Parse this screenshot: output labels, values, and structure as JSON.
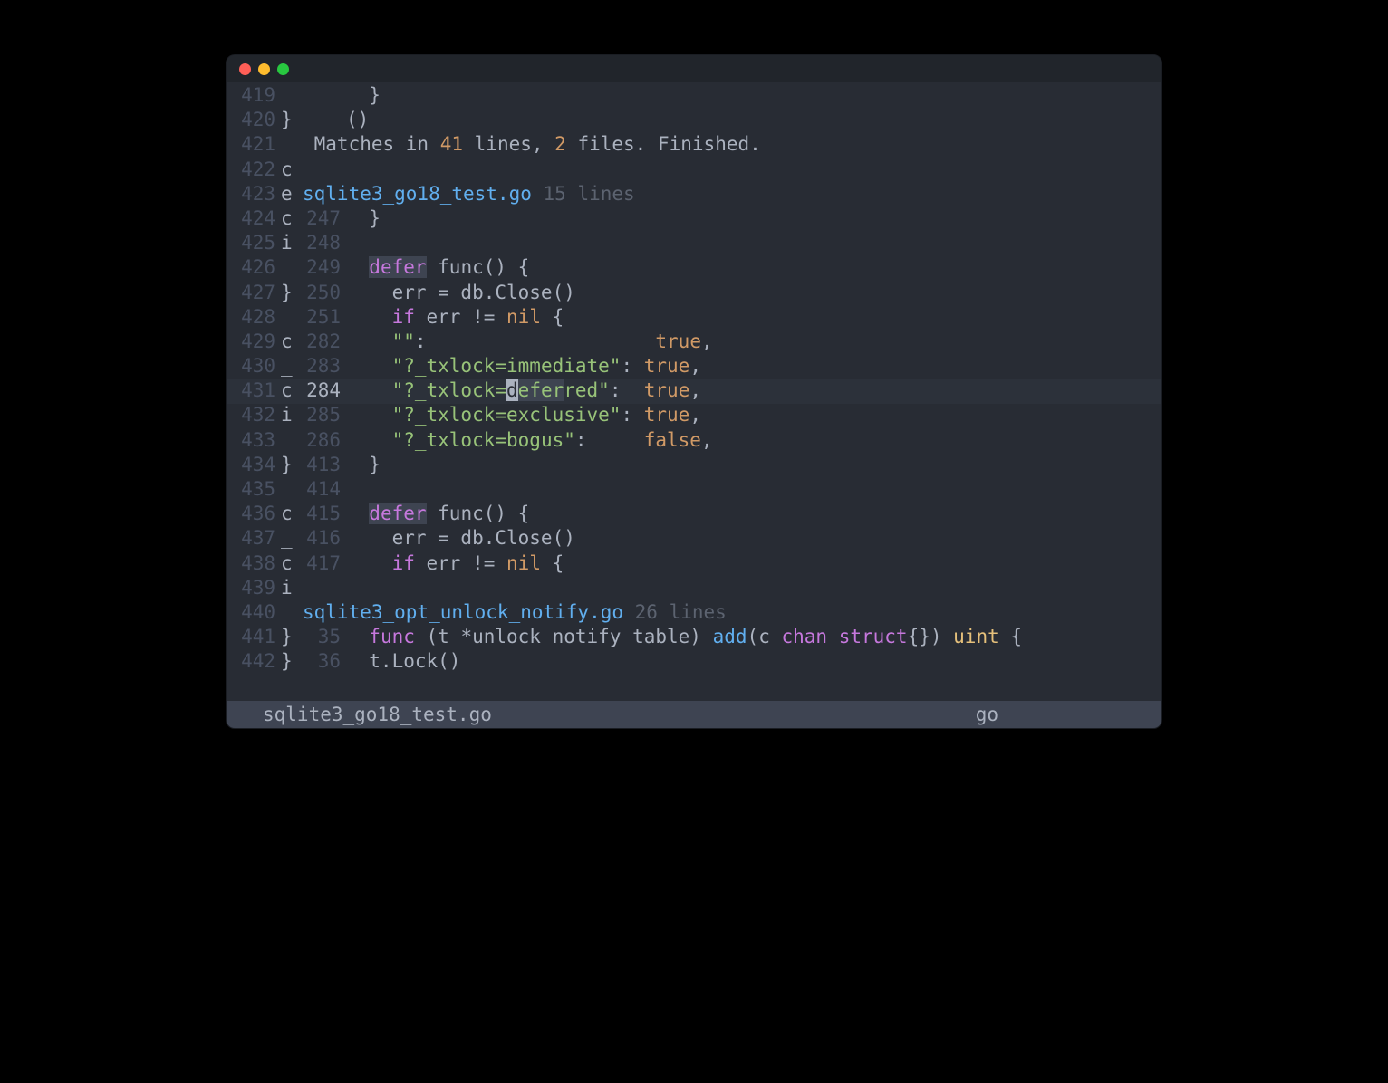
{
  "search": {
    "summary_prefix": " Matches in ",
    "lines_count": "41",
    "summary_mid1": " lines, ",
    "files_count": "2",
    "summary_suffix": " files. Finished."
  },
  "file1": {
    "name": "sqlite3_go18_test.go",
    "line_count": " 15 lines"
  },
  "file2": {
    "name": "sqlite3_opt_unlock_notify.go",
    "line_count": " 26 lines"
  },
  "gutter": {
    "l419": "419",
    "l420": "420",
    "l421": "421",
    "l422": "422",
    "l423": "423",
    "l424": "424",
    "l425": "425",
    "l426": "426",
    "l427": "427",
    "l428": "428",
    "l429": "429",
    "l430": "430",
    "l431": "431",
    "l432": "432",
    "l433": "433",
    "l434": "434",
    "l435": "435",
    "l436": "436",
    "l437": "437",
    "l438": "438",
    "l439": "439",
    "l440": "440",
    "l441": "441",
    "l442": "442"
  },
  "mid": {
    "l419": " ",
    "l420": "}",
    "l421": " ",
    "l422": "c",
    "l423": "e",
    "l424": "c",
    "l425": "i",
    "l426": " ",
    "l427": "}",
    "l428": " ",
    "l429": "c",
    "l430": "_",
    "l431": "c",
    "l432": "i",
    "l433": " ",
    "l434": "}",
    "l435": " ",
    "l436": "c",
    "l437": "_",
    "l438": "c",
    "l439": "i",
    "l440": " ",
    "l441": "}",
    "l442": "}"
  },
  "rgutter": {
    "r247": "247",
    "r248": "248",
    "r249": "249",
    "r250": "250",
    "r251": "251",
    "r282": "282",
    "r283": "283",
    "r284": "284",
    "r285": "285",
    "r286": "286",
    "r413": "413",
    "r414": "414",
    "r415": "415",
    "r416": "416",
    "r417": "417",
    "r35": "35",
    "r36": "36"
  },
  "code": {
    "c419": "  }",
    "c420": "()",
    "c424": "  }",
    "c426_defer": "defer",
    "c426_rest": " func() {",
    "c427": "    err = db.Close()",
    "c428_a": "    ",
    "c428_if": "if",
    "c428_b": " err != ",
    "c428_nil": "nil",
    "c428_c": " {",
    "c429_a": "    ",
    "c429_str": "\"\"",
    "c429_b": ":                    ",
    "c429_bool": "true",
    "c429_c": ",",
    "c430_a": "    ",
    "c430_str": "\"?_txlock=immediate\"",
    "c430_b": ": ",
    "c430_bool": "true",
    "c430_c": ",",
    "c431_a": "    ",
    "c431_str_a": "\"?_txlock=",
    "c431_cursor": "d",
    "c431_str_b": "efer",
    "c431_str_c": "red\"",
    "c431_b": ":  ",
    "c431_bool": "true",
    "c431_c": ",",
    "c432_a": "    ",
    "c432_str": "\"?_txlock=exclusive\"",
    "c432_b": ": ",
    "c432_bool": "true",
    "c432_c": ",",
    "c433_a": "    ",
    "c433_str": "\"?_txlock=bogus\"",
    "c433_b": ":     ",
    "c433_bool": "false",
    "c433_c": ",",
    "c434": "  }",
    "c436_defer": "defer",
    "c436_rest": " func() {",
    "c437": "    err = db.Close()",
    "c438_a": "    ",
    "c438_if": "if",
    "c438_b": " err != ",
    "c438_nil": "nil",
    "c438_c": " {",
    "c441_func": "func",
    "c441_a": " (t *unlock_notify_table) ",
    "c441_add": "add",
    "c441_b": "(c ",
    "c441_chan": "chan",
    "c441_c": " ",
    "c441_struct": "struct",
    "c441_d": "{}) ",
    "c441_uint": "uint",
    "c441_e": " {",
    "c442": "  t.Lock()"
  },
  "status": {
    "filename": "sqlite3_go18_test.go",
    "lang": "go"
  }
}
